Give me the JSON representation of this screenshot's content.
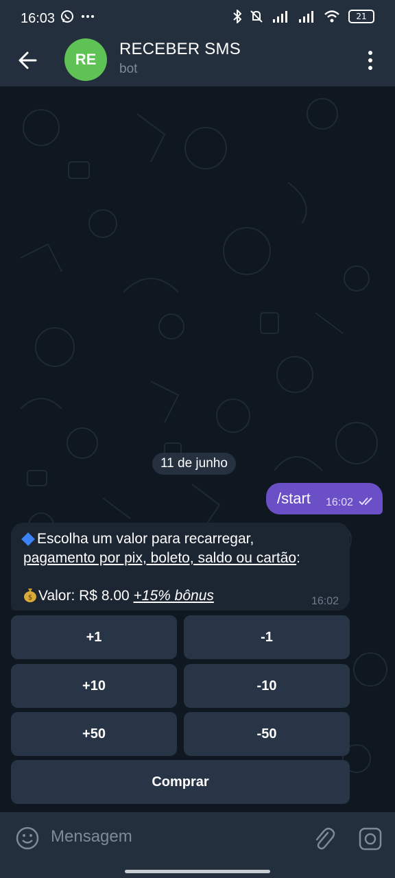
{
  "status_bar": {
    "time": "16:03",
    "battery": "21",
    "left_icons": [
      "whatsapp-icon",
      "more-dots-icon"
    ],
    "right_icons": [
      "bluetooth-icon",
      "mute-icon",
      "signal-icon",
      "signal-icon",
      "wifi-icon",
      "battery-icon"
    ]
  },
  "header": {
    "back_icon": "arrow-left-icon",
    "avatar_initials": "RE",
    "avatar_color": "#5fc254",
    "title": "RECEBER SMS",
    "subtitle": "bot",
    "menu_icon": "more-vertical-icon"
  },
  "chat": {
    "date_separator": "11 de junho",
    "outgoing": {
      "text": "/start",
      "time": "16:02",
      "bubble_color": "#6b4fc7"
    },
    "incoming": {
      "line1": "Escolha um valor para recarregar,",
      "line2": "pagamento por pix, boleto, saldo ou cartão",
      "line2_suffix": ":",
      "line3_prefix": "Valor: R$ 8.00 ",
      "line3_bonus": "+15% bônus",
      "time": "16:02"
    },
    "keyboard": {
      "plus1": "+1",
      "minus1": "-1",
      "plus10": "+10",
      "minus10": "-10",
      "plus50": "+50",
      "minus50": "-50",
      "buy": "Comprar"
    }
  },
  "input_bar": {
    "placeholder": "Mensagem",
    "icons": [
      "emoji-icon",
      "paperclip-icon",
      "camera-icon"
    ]
  }
}
